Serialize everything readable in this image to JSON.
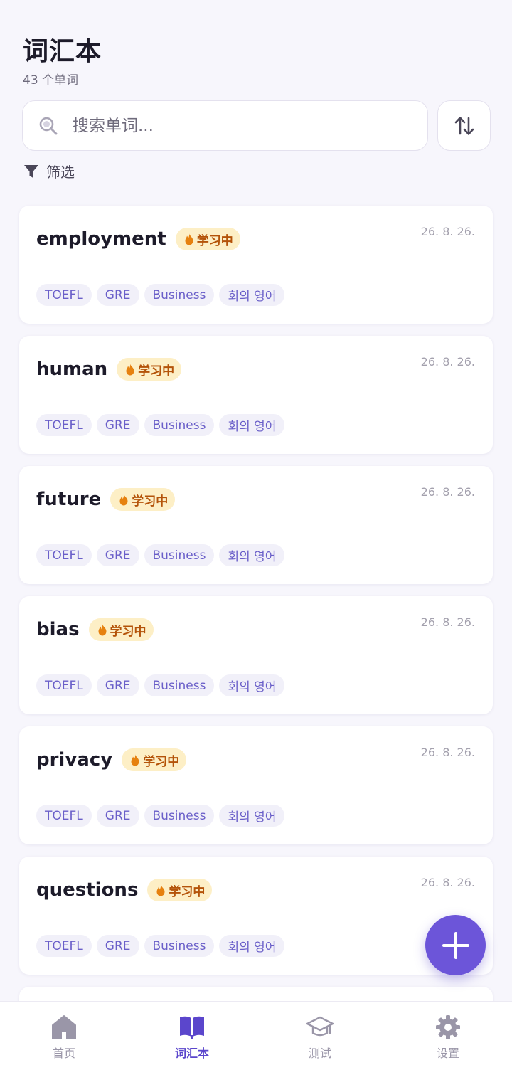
{
  "header": {
    "title": "词汇本",
    "subtitle": "43 个单词"
  },
  "search": {
    "placeholder": "搜索单词..."
  },
  "filter": {
    "label": "筛选"
  },
  "words": [
    {
      "word": "employment",
      "status": "学习中",
      "date": "26. 8. 26.",
      "tags": [
        "TOEFL",
        "GRE",
        "Business",
        "회의 영어"
      ]
    },
    {
      "word": "human",
      "status": "学习中",
      "date": "26. 8. 26.",
      "tags": [
        "TOEFL",
        "GRE",
        "Business",
        "회의 영어"
      ]
    },
    {
      "word": "future",
      "status": "学习中",
      "date": "26. 8. 26.",
      "tags": [
        "TOEFL",
        "GRE",
        "Business",
        "회의 영어"
      ]
    },
    {
      "word": "bias",
      "status": "学习中",
      "date": "26. 8. 26.",
      "tags": [
        "TOEFL",
        "GRE",
        "Business",
        "회의 영어"
      ]
    },
    {
      "word": "privacy",
      "status": "学习中",
      "date": "26. 8. 26.",
      "tags": [
        "TOEFL",
        "GRE",
        "Business",
        "회의 영어"
      ]
    },
    {
      "word": "questions",
      "status": "学习中",
      "date": "26. 8. 26.",
      "tags": [
        "TOEFL",
        "GRE",
        "Business",
        "회의 영어"
      ]
    }
  ],
  "nav": {
    "items": [
      {
        "label": "首页",
        "icon": "home-icon",
        "active": false
      },
      {
        "label": "词汇本",
        "icon": "book-icon",
        "active": true
      },
      {
        "label": "测试",
        "icon": "graduation-cap-icon",
        "active": false
      },
      {
        "label": "设置",
        "icon": "gear-icon",
        "active": false
      }
    ]
  },
  "colors": {
    "accent": "#6c55d9",
    "status_bg": "#fdefc6",
    "status_text": "#b45309",
    "tag_bg": "#f1f0f9",
    "tag_text": "#6a5fc9",
    "background": "#f7f6fc"
  }
}
